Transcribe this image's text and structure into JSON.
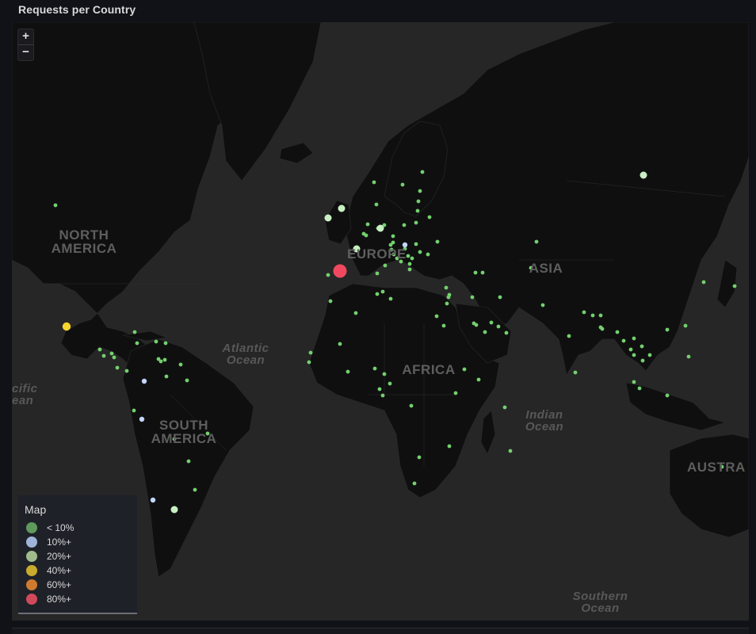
{
  "panel": {
    "title": "Requests per Country"
  },
  "zoom": {
    "in_label": "+",
    "out_label": "−"
  },
  "map_labels": {
    "north_america": "NORTH AMERICA",
    "south_america": "SOUTH AMERICA",
    "europe": "EUROPE",
    "asia": "ASIA",
    "africa": "AFRICA",
    "australia": "AUSTRA",
    "atlantic": "Atlantic Ocean",
    "pacific": "cific ean",
    "indian": "Indian Ocean",
    "southern": "Southern Ocean"
  },
  "legend": {
    "title": "Map",
    "items": [
      {
        "label": "< 10%",
        "color": "#5f9a5c"
      },
      {
        "label": "10%+",
        "color": "#9fb4d8"
      },
      {
        "label": "20%+",
        "color": "#9fbb8c"
      },
      {
        "label": "40%+",
        "color": "#c8aa2c"
      },
      {
        "label": "60%+",
        "color": "#cf7a2e"
      },
      {
        "label": "80%+",
        "color": "#d04a5b"
      }
    ]
  },
  "colors": {
    "map_land": "#0f0f10",
    "map_water": "#262626",
    "marker_base": "#73d16d",
    "marker_10": "#c5d6ff",
    "marker_20": "#c8f0c3",
    "marker_40": "#f6d52c",
    "marker_80": "#f0495f"
  }
}
